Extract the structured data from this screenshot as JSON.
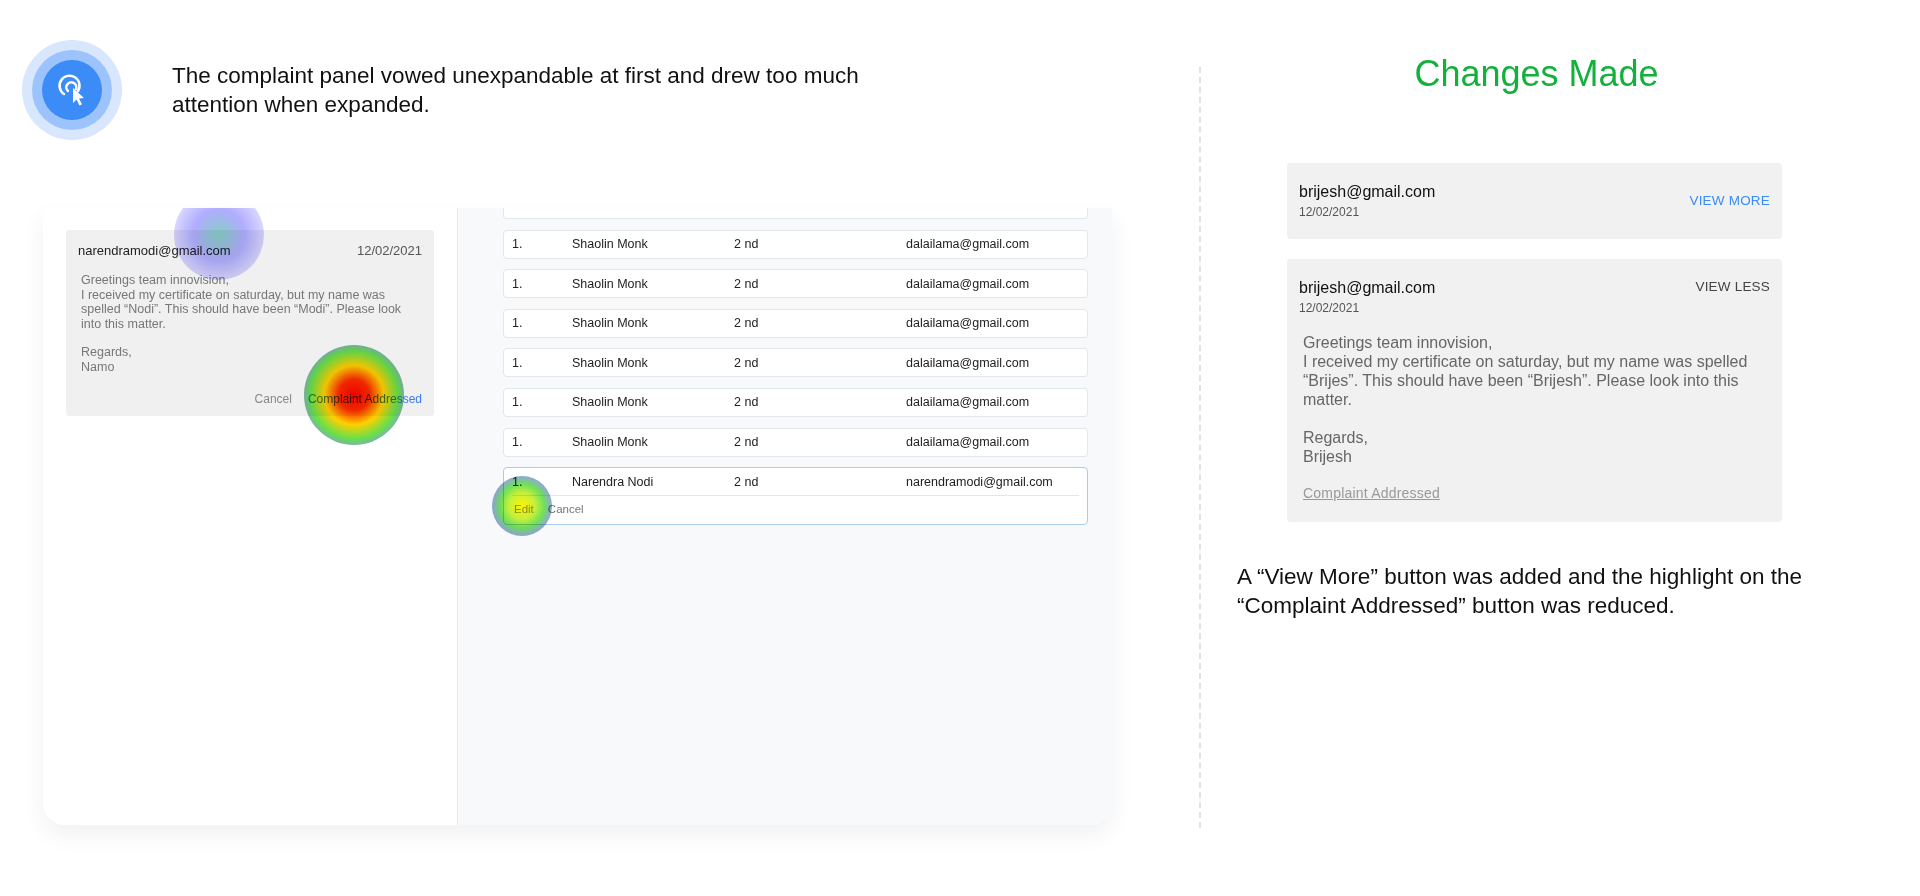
{
  "insight": {
    "text": "The complaint panel vowed unexpandable at first and drew too much attention when expanded."
  },
  "before": {
    "complaint": {
      "email": "narendramodi@gmail.com",
      "date": "12/02/2021",
      "body": "Greetings team innovision,\nI received my certificate on saturday, but my name was spelled “Nodi”. This should have been  “Modi”. Please look into this matter.",
      "signoff": "Regards,\nNamo",
      "buttons": [
        {
          "label": "Cancel",
          "kind": "secondary"
        },
        {
          "label": "Complaint Addressed",
          "kind": "primary"
        }
      ]
    },
    "rows": [
      {
        "cells": [
          "1.",
          "Shaolin Monk",
          "2 nd",
          "dalailama@gmail.com"
        ],
        "expanded": false
      },
      {
        "cells": [
          "1.",
          "Shaolin Monk",
          "2 nd",
          "dalailama@gmail.com"
        ],
        "expanded": false
      },
      {
        "cells": [
          "1.",
          "Shaolin Monk",
          "2 nd",
          "dalailama@gmail.com"
        ],
        "expanded": false
      },
      {
        "cells": [
          "1.",
          "Shaolin Monk",
          "2 nd",
          "dalailama@gmail.com"
        ],
        "expanded": false
      },
      {
        "cells": [
          "1.",
          "Shaolin Monk",
          "2 nd",
          "dalailama@gmail.com"
        ],
        "expanded": false
      },
      {
        "cells": [
          "1.",
          "Shaolin Monk",
          "2 nd",
          "dalailama@gmail.com"
        ],
        "expanded": false
      },
      {
        "cells": [
          "1.",
          "Narendra Nodi",
          "2 nd",
          "narendramodi@gmail.com"
        ],
        "expanded": true,
        "actions": [
          {
            "label": "Edit",
            "disabled": true
          },
          {
            "label": "Cancel",
            "disabled": false
          }
        ]
      }
    ]
  },
  "after": {
    "title": "Changes Made",
    "cards": [
      {
        "email": "brijesh@gmail.com",
        "date": "12/02/2021",
        "toggle": "VIEW MORE",
        "expanded": false
      },
      {
        "email": "brijesh@gmail.com",
        "date": "12/02/2021",
        "toggle": "VIEW LESS",
        "expanded": true,
        "body": "Greetings team innovision,\nI received my certificate on saturday, but my name was spelled “Brijes”. This should have been  “Brijesh”. Please look into this matter.",
        "signoff": "Regards,\nBrijesh",
        "action": "Complaint Addressed"
      }
    ],
    "caption": "A “View More” button was added and the highlight on the “Complaint Addressed” button was reduced."
  }
}
